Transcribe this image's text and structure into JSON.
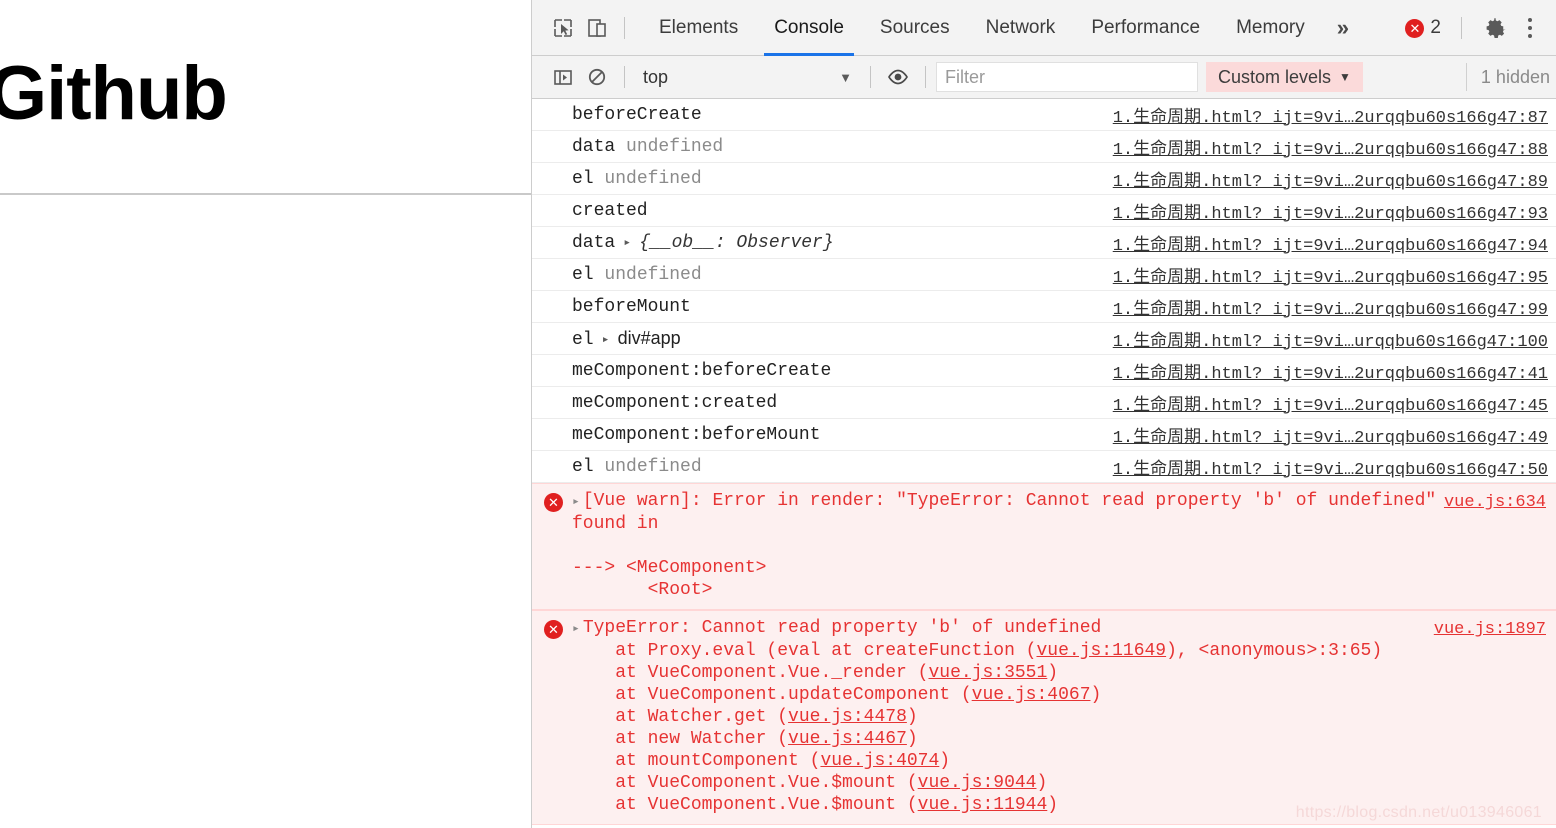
{
  "page": {
    "heading": "Github"
  },
  "devtools": {
    "toolbar": {
      "inspect_icon": "inspect-cursor-icon",
      "device_icon": "device-toolbar-icon",
      "tabs": [
        {
          "label": "Elements",
          "active": false
        },
        {
          "label": "Console",
          "active": true
        },
        {
          "label": "Sources",
          "active": false
        },
        {
          "label": "Network",
          "active": false
        },
        {
          "label": "Performance",
          "active": false
        },
        {
          "label": "Memory",
          "active": false
        }
      ],
      "more_tabs_glyph": "»",
      "error_count": "2",
      "error_glyph": "✕",
      "settings_icon": "gear-icon",
      "menu_icon": "kebab-menu-icon"
    },
    "filter_bar": {
      "sidebar_toggle_icon": "console-sidebar-icon",
      "clear_icon": "clear-console-icon",
      "context": "top",
      "context_caret": "▼",
      "eye_icon": "live-expression-eye-icon",
      "filter_placeholder": "Filter",
      "filter_value": "",
      "levels_label": "Custom levels",
      "levels_caret": "▼",
      "hidden_note": "1 hidden"
    },
    "messages": [
      {
        "label": "beforeCreate",
        "value": "",
        "kind": "plain",
        "source": "1.生命周期.html?_ijt=9vi…2urqqbu60s166g47:87"
      },
      {
        "label": "data",
        "value": "undefined",
        "kind": "dim",
        "source": "1.生命周期.html?_ijt=9vi…2urqqbu60s166g47:88"
      },
      {
        "label": "el",
        "value": "undefined",
        "kind": "dim",
        "source": "1.生命周期.html?_ijt=9vi…2urqqbu60s166g47:89"
      },
      {
        "label": "created",
        "value": "",
        "kind": "plain",
        "source": "1.生命周期.html?_ijt=9vi…2urqqbu60s166g47:93"
      },
      {
        "label": "data",
        "value": "{__ob__: Observer}",
        "kind": "object",
        "source": "1.生命周期.html?_ijt=9vi…2urqqbu60s166g47:94"
      },
      {
        "label": "el",
        "value": "undefined",
        "kind": "dim",
        "source": "1.生命周期.html?_ijt=9vi…2urqqbu60s166g47:95"
      },
      {
        "label": "beforeMount",
        "value": "",
        "kind": "plain",
        "source": "1.生命周期.html?_ijt=9vi…2urqqbu60s166g47:99"
      },
      {
        "label": "el",
        "value": "div#app",
        "kind": "node",
        "source": "1.生命周期.html?_ijt=9vi…urqqbu60s166g47:100"
      },
      {
        "label": "meComponent:beforeCreate",
        "value": "",
        "kind": "plain",
        "source": "1.生命周期.html?_ijt=9vi…2urqqbu60s166g47:41"
      },
      {
        "label": "meComponent:created",
        "value": "",
        "kind": "plain",
        "source": "1.生命周期.html?_ijt=9vi…2urqqbu60s166g47:45"
      },
      {
        "label": "meComponent:beforeMount",
        "value": "",
        "kind": "plain",
        "source": "1.生命周期.html?_ijt=9vi…2urqqbu60s166g47:49"
      },
      {
        "label": "el",
        "value": "undefined",
        "kind": "dim",
        "source": "1.生命周期.html?_ijt=9vi…2urqqbu60s166g47:50"
      }
    ],
    "warn_block": {
      "icon_glyph": "✕",
      "triangle": "▸",
      "headline": "[Vue warn]: Error in render: \"TypeError: Cannot read property 'b' of undefined\"",
      "body": "\nfound in\n\n---> <MeComponent>\n       <Root>",
      "source": "vue.js:634"
    },
    "error_block": {
      "icon_glyph": "✕",
      "triangle": "▸",
      "headline": "TypeError: Cannot read property 'b' of undefined",
      "source": "vue.js:1897",
      "stack": [
        {
          "text": "    at Proxy.eval (eval at createFunction (",
          "link": "vue.js:11649",
          "tail": "), <anonymous>:3:65)"
        },
        {
          "text": "    at VueComponent.Vue._render (",
          "link": "vue.js:3551",
          "tail": ")"
        },
        {
          "text": "    at VueComponent.updateComponent (",
          "link": "vue.js:4067",
          "tail": ")"
        },
        {
          "text": "    at Watcher.get (",
          "link": "vue.js:4478",
          "tail": ")"
        },
        {
          "text": "    at new Watcher (",
          "link": "vue.js:4467",
          "tail": ")"
        },
        {
          "text": "    at mountComponent (",
          "link": "vue.js:4074",
          "tail": ")"
        },
        {
          "text": "    at VueComponent.Vue.$mount (",
          "link": "vue.js:9044",
          "tail": ")"
        },
        {
          "text": "    at VueComponent.Vue.$mount (",
          "link": "vue.js:11944",
          "tail": ")"
        }
      ]
    }
  },
  "watermark": "https://blog.csdn.net/u013946061",
  "colors": {
    "accent": "#1a73e8",
    "error_red": "#e02020",
    "error_text": "#e63333",
    "error_bg": "#fdf0f0",
    "toolbar_bg": "#f3f3f3",
    "levels_bg": "#fbdada"
  }
}
